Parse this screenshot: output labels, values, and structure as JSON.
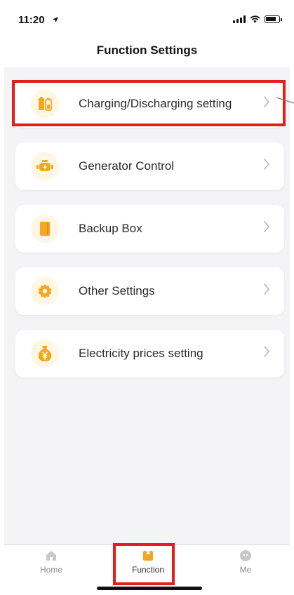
{
  "status_bar": {
    "time": "11:20"
  },
  "header": {
    "title": "Function Settings"
  },
  "menu": {
    "items": [
      {
        "label": "Charging/Discharging setting",
        "icon": "battery-charge-icon"
      },
      {
        "label": "Generator Control",
        "icon": "generator-icon"
      },
      {
        "label": "Backup Box",
        "icon": "backup-box-icon"
      },
      {
        "label": "Other Settings",
        "icon": "gear-icon"
      },
      {
        "label": "Electricity prices setting",
        "icon": "money-bag-icon"
      }
    ]
  },
  "tab_bar": {
    "tabs": [
      {
        "label": "Home",
        "icon": "home-icon"
      },
      {
        "label": "Function",
        "icon": "function-icon",
        "active": true
      },
      {
        "label": "Me",
        "icon": "profile-icon"
      }
    ]
  },
  "colors": {
    "accent": "#f5a623",
    "icon_bg": "#fff7e3",
    "highlight": "#e41d1d",
    "page_bg": "#f4f4f6"
  }
}
